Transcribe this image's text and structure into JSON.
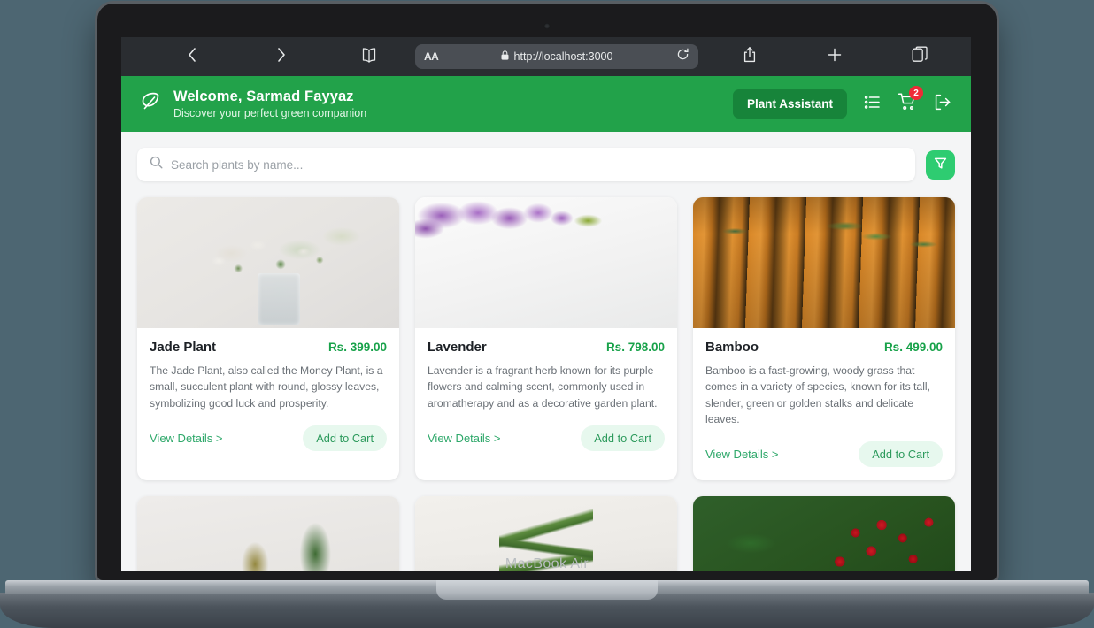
{
  "device": {
    "model_label": "MacBook Air"
  },
  "browser": {
    "back_icon": "chevron-left-icon",
    "forward_icon": "chevron-right-icon",
    "reader_icon": "book-icon",
    "text_size_label": "AA",
    "lock_icon": "lock-icon",
    "url": "http://localhost:3000",
    "reload_icon": "reload-icon",
    "share_icon": "share-icon",
    "new_tab_icon": "plus-icon",
    "tabs_icon": "tabs-icon"
  },
  "header": {
    "logo_icon": "leaf-icon",
    "title": "Welcome, Sarmad Fayyaz",
    "subtitle": "Discover your perfect green companion",
    "assistant_button": "Plant Assistant",
    "list_icon": "list-icon",
    "cart_icon": "cart-icon",
    "cart_badge": "2",
    "logout_icon": "logout-icon",
    "bg_color": "#22a24a",
    "assistant_bg_color": "#17843a",
    "badge_color": "#ef2b36"
  },
  "search": {
    "placeholder": "Search plants by name...",
    "value": "",
    "search_icon": "search-icon",
    "filter_icon": "filter-icon",
    "filter_bg_color": "#2ecc71"
  },
  "products": [
    {
      "name": "Jade Plant",
      "price": "Rs. 399.00",
      "description": "The Jade Plant, also called the Money Plant, is a small, succulent plant with round, glossy leaves, symbolizing good luck and prosperity.",
      "view_details": "View Details >",
      "add_to_cart": "Add to Cart",
      "image_style": "img-jade"
    },
    {
      "name": "Lavender",
      "price": "Rs. 798.00",
      "description": "Lavender is a fragrant herb known for its purple flowers and calming scent, commonly used in aromatherapy and as a decorative garden plant.",
      "view_details": "View Details >",
      "add_to_cart": "Add to Cart",
      "image_style": "img-lavender"
    },
    {
      "name": "Bamboo",
      "price": "Rs. 499.00",
      "description": "Bamboo is a fast-growing, woody grass that comes in a variety of species, known for its tall, slender, green or golden stalks and delicate leaves.",
      "view_details": "View Details >",
      "add_to_cart": "Add to Cart",
      "image_style": "img-bamboo"
    },
    {
      "name": "",
      "price": "",
      "description": "",
      "view_details": "",
      "add_to_cart": "",
      "image_style": "img-potted"
    },
    {
      "name": "",
      "price": "",
      "description": "",
      "view_details": "",
      "add_to_cart": "",
      "image_style": "img-snake"
    },
    {
      "name": "",
      "price": "",
      "description": "",
      "view_details": "",
      "add_to_cart": "",
      "image_style": "img-coffee"
    }
  ],
  "theme": {
    "page_bg": "#f4f5f6",
    "desktop_bg": "#4d6672",
    "price_green": "#18a24a",
    "link_green": "#2ea86a",
    "add_cart_bg": "#e7f8ee"
  }
}
